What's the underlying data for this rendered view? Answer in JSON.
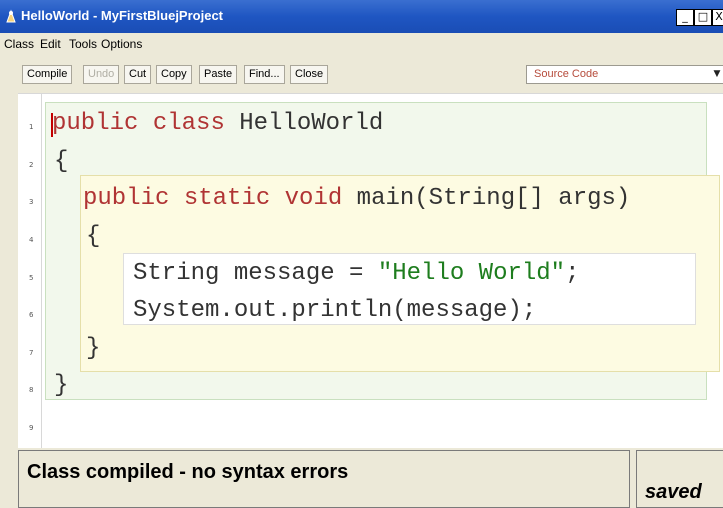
{
  "window": {
    "title": "HelloWorld - MyFirstBluejProject",
    "controls": {
      "minimize": "_",
      "maximize": "□",
      "close": "X"
    }
  },
  "menu": {
    "items": [
      {
        "label": "Class"
      },
      {
        "label": "Edit"
      },
      {
        "label": "Tools"
      },
      {
        "label": "Options"
      }
    ]
  },
  "toolbar": {
    "buttons": [
      {
        "label": "Compile",
        "enabled": true
      },
      {
        "label": "Undo",
        "enabled": false
      },
      {
        "label": "Cut",
        "enabled": true
      },
      {
        "label": "Copy",
        "enabled": true
      },
      {
        "label": "Paste",
        "enabled": true
      },
      {
        "label": "Find...",
        "enabled": true
      },
      {
        "label": "Close",
        "enabled": true
      }
    ],
    "view_selector": {
      "selected": "Source Code"
    }
  },
  "editor": {
    "line_numbers": [
      "1",
      "2",
      "3",
      "4",
      "5",
      "6",
      "7",
      "8",
      "9"
    ],
    "lines": {
      "l1": {
        "kw1": "public",
        "kw2": "class",
        "rest": " HelloWorld"
      },
      "l2": {
        "text": "{"
      },
      "l3": {
        "kw1": "public",
        "kw2": "static",
        "kw3": "void",
        "rest": " main(String[] args)"
      },
      "l4": {
        "text": "{"
      },
      "l5": {
        "pre": "String message = ",
        "str": "\"Hello World\"",
        "post": ";"
      },
      "l6": {
        "text": "System.out.println(message);"
      },
      "l7": {
        "text": "}"
      },
      "l8": {
        "text": "}"
      }
    },
    "colors": {
      "keyword": "#b03434",
      "string": "#1e7d1e",
      "class_scope": "#f2f8ec",
      "method_scope": "#fdfbe2"
    }
  },
  "status": {
    "message": "Class compiled - no syntax errors",
    "saved": "saved"
  }
}
